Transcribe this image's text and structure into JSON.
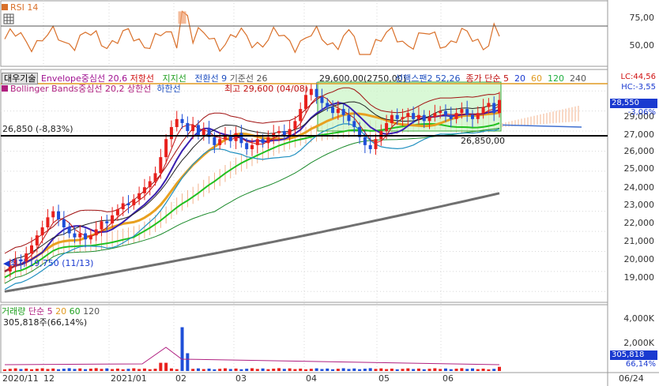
{
  "rsi": {
    "title": "RSI 14",
    "levels": [
      "75,00",
      "50,00"
    ]
  },
  "price_panel": {
    "legend": {
      "badge": "대우기술",
      "envelope": "Envelope중심선 20,6",
      "lower": "저항선",
      "support": "지지선",
      "conversion": "전환선 9",
      "base": "기준선 26",
      "leading": "선행스팬2 52,26",
      "close_ma": "종가 단순 5",
      "p20": "20",
      "p60": "60",
      "p120": "120",
      "p240": "240",
      "bollinger": "Bollinger Bands중심선 20,2",
      "upper_band": "상한선",
      "lower_band": "하한선",
      "high_note": "최고 29,600 (04/08)",
      "top_value": "29,600,00(2750,00)"
    },
    "ref_line_label": "26,850 (-8,83%)",
    "ref_line_value": "26,850,00",
    "low_note": "최저 19,750 (11/13)",
    "y_labels": [
      "29,000",
      "28,000",
      "27,000",
      "26,000",
      "25,000",
      "24,000",
      "23,000",
      "22,000",
      "21,000",
      "20,000",
      "19,000"
    ],
    "tags": {
      "lc": "LC:44,56",
      "hc": "HC:-3,55",
      "price": "28,550",
      "pct": "-3,06%"
    }
  },
  "volume": {
    "legend_title": "거래량",
    "legend_ma": "단순 5",
    "p20": "20",
    "p60": "60",
    "p120": "120",
    "summary": "305,818주(66,14%)",
    "y_labels": [
      "4,000K",
      "2,000K"
    ],
    "tags": {
      "value": "305,818",
      "pct": "66,14%"
    }
  },
  "x_labels": [
    "2020/11",
    "12",
    "2021/01",
    "02",
    "03",
    "04",
    "05",
    "06",
    "06/24"
  ],
  "colors": {
    "up": "#e8201c",
    "down": "#1f4fd8",
    "rsi": "#d9702a",
    "bg": "#ffffff",
    "grid": "#d8d8d8"
  },
  "chart_data": {
    "type": "candlestick",
    "title": "",
    "price_range": [
      18500,
      29600
    ],
    "ref_price": 26850,
    "high": {
      "value": 29600,
      "date": "04/08"
    },
    "low": {
      "value": 19750,
      "date": "11/13"
    },
    "last_close": 28550,
    "change_pct": -3.06,
    "price_series_approx": [
      20000,
      20300,
      20600,
      20500,
      20900,
      21300,
      21800,
      22200,
      22700,
      23000,
      22600,
      22200,
      21900,
      21700,
      21900,
      21600,
      21800,
      22100,
      22500,
      22400,
      22800,
      23100,
      23400,
      23300,
      23600,
      23900,
      24200,
      24500,
      24900,
      25700,
      26600,
      27200,
      27600,
      27400,
      27000,
      27300,
      26800,
      27100,
      26700,
      26300,
      26600,
      26800,
      26500,
      26900,
      26400,
      26100,
      26300,
      26600,
      26400,
      26700,
      26900,
      27000,
      26800,
      27100,
      27500,
      28100,
      28800,
      29100,
      28700,
      28400,
      28200,
      27900,
      28100,
      27800,
      27500,
      27200,
      26700,
      26300,
      26100,
      26600,
      27000,
      27400,
      27800,
      27600,
      27700,
      27900,
      27600,
      27800,
      27500,
      27700,
      27900,
      28000,
      27800,
      27600,
      27900,
      28100,
      27800,
      27600,
      27900,
      28200,
      28400,
      27900,
      28550
    ],
    "ma120_range": [
      19000,
      23900
    ],
    "volume_range_k": [
      0,
      4500
    ],
    "last_volume": 305818,
    "volume_pct": 66.14,
    "rsi_levels": [
      75,
      50
    ],
    "x_ticks": [
      "2020/11",
      "12",
      "2021/01",
      "02",
      "03",
      "04",
      "05",
      "06",
      "06/24"
    ]
  }
}
